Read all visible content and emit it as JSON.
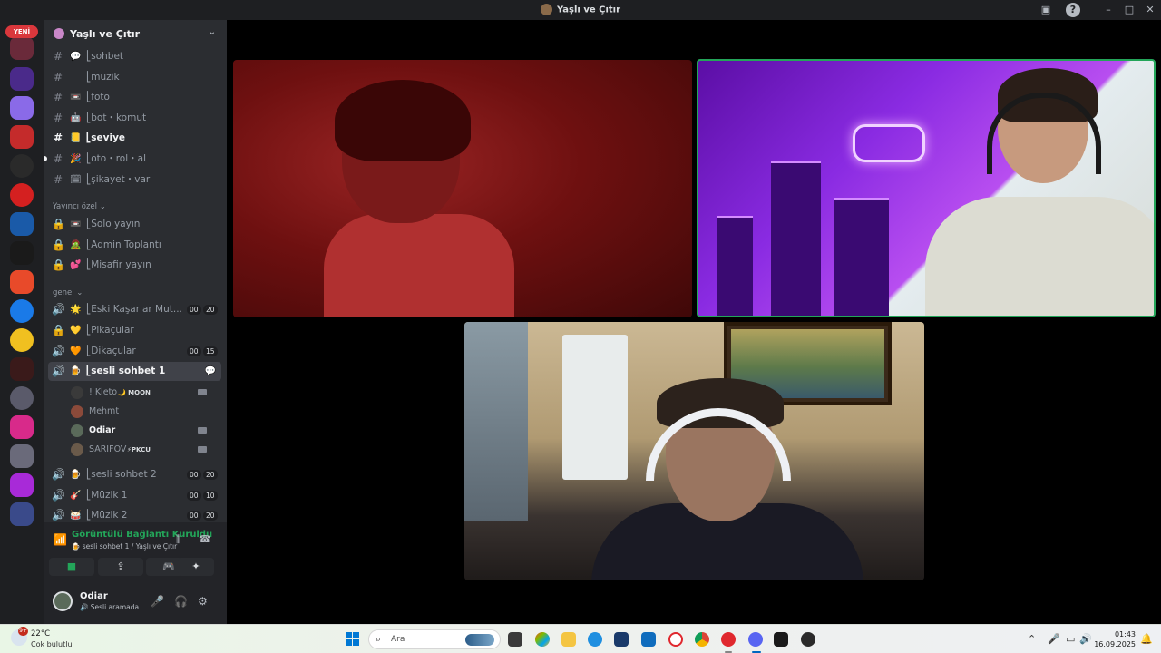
{
  "window": {
    "title": "Yaşlı ve Çıtır"
  },
  "rail": {
    "new_badge": "YENİ"
  },
  "guild": {
    "name": "Yaşlı ve Çıtır"
  },
  "text_channels": [
    {
      "emoji": "💬",
      "name": "⎣sohbet"
    },
    {
      "emoji": "",
      "name": "⎣müzik"
    },
    {
      "emoji": "📼",
      "name": "⎣foto"
    },
    {
      "emoji": "🤖",
      "name": "⎣bot・komut"
    },
    {
      "emoji": "📒",
      "name": "⎣seviye"
    },
    {
      "emoji": "🎉",
      "name": "⎣oto・rol・al"
    },
    {
      "emoji": "🗓",
      "name": "⎣şikayet・var"
    }
  ],
  "categories": {
    "yayinci": "Yayıncı özel ⌄",
    "genel": "genel ⌄"
  },
  "private_channels": [
    {
      "emoji": "📼",
      "name": "⎣Solo yayın"
    },
    {
      "emoji": "🧟",
      "name": "⎣Admin Toplantı"
    },
    {
      "emoji": "💕",
      "name": "⎣Misafir yayın"
    }
  ],
  "voice_channels": [
    {
      "emoji": "🌟",
      "name": "⎣Eski Kaşarlar Mut...",
      "count_a": "00",
      "count_b": "20"
    },
    {
      "emoji": "💛",
      "name": "⎣Pikaçular",
      "count_a": "",
      "count_b": ""
    },
    {
      "emoji": "🧡",
      "name": "⎣Dikaçular",
      "count_a": "00",
      "count_b": "15"
    },
    {
      "emoji": "🍺",
      "name": "⎣sesli sohbet 1",
      "count_a": "",
      "count_b": ""
    },
    {
      "emoji": "🍺",
      "name": "⎣sesli sohbet 2",
      "count_a": "00",
      "count_b": "20"
    },
    {
      "emoji": "🎸",
      "name": "⎣Müzik 1",
      "count_a": "00",
      "count_b": "10"
    },
    {
      "emoji": "🥁",
      "name": "⎣Müzik 2",
      "count_a": "00",
      "count_b": "20"
    }
  ],
  "voice_users": [
    {
      "name": "! Kleto",
      "tag": "🌙 MOON",
      "color": "#3a3a3a"
    },
    {
      "name": "Mehmt",
      "tag": "",
      "color": "#8b4a3a"
    },
    {
      "name": "Odiar",
      "tag": "",
      "color": "#5a6a5a"
    },
    {
      "name": "SARIFOV",
      "tag": "⚡PKCU",
      "color": "#6a5a4a"
    }
  ],
  "voice_panel": {
    "status": "Görüntülü Bağlantı Kuruldu",
    "location": "🍺 sesli sohbet 1 / Yaşlı ve Çıtır"
  },
  "user_panel": {
    "name": "Odiar",
    "status": "🔊 Sesli aramada"
  },
  "taskbar": {
    "temperature": "22°C",
    "weather": "Çok bulutlu",
    "weather_badge": "9+",
    "search_placeholder": "Ara",
    "time": "01:43",
    "date": "16.09.2025"
  },
  "colors": {
    "accent_green": "#23a559",
    "badge_red": "#da373c",
    "sidebar_bg": "#2b2d31"
  }
}
